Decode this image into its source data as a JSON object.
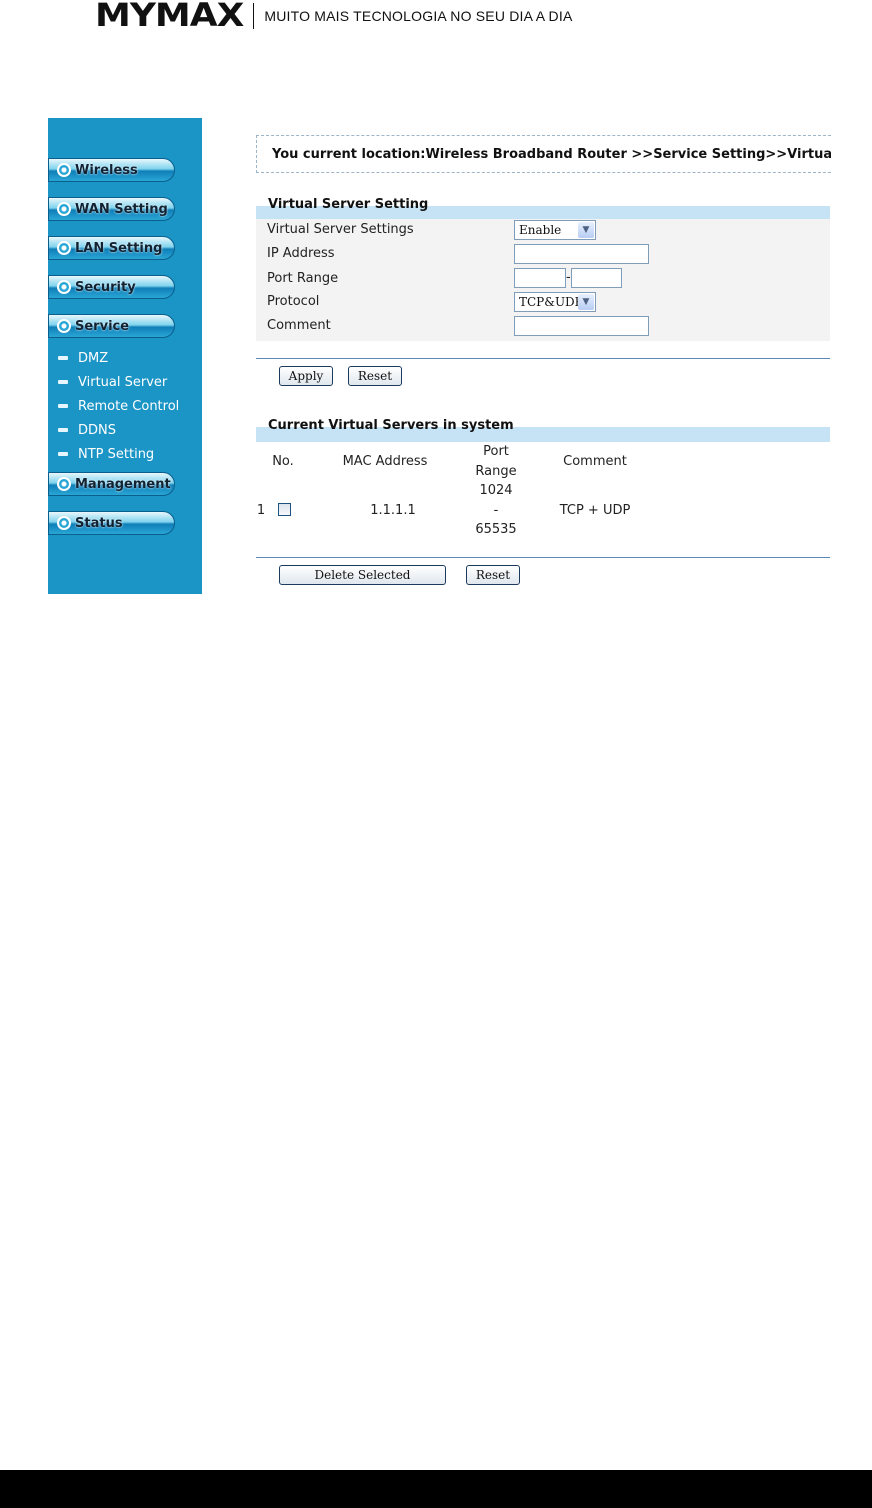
{
  "brand": {
    "logo_text": "MYMAX",
    "tagline": "MUITO MAIS TECNOLOGIA NO SEU DIA A DIA"
  },
  "sidebar": {
    "items": [
      {
        "label": "Wireless"
      },
      {
        "label": "WAN Setting"
      },
      {
        "label": "LAN Setting"
      },
      {
        "label": "Security"
      },
      {
        "label": "Service"
      }
    ],
    "service_sub": [
      {
        "label": "DMZ"
      },
      {
        "label": "Virtual Server"
      },
      {
        "label": "Remote Control"
      },
      {
        "label": "DDNS"
      },
      {
        "label": "NTP Setting"
      }
    ],
    "after": [
      {
        "label": "Management"
      },
      {
        "label": "Status"
      }
    ]
  },
  "location": {
    "text": "You current location:Wireless Broadband Router >>Service Setting>>Virtual Server"
  },
  "settings": {
    "title": "Virtual Server Setting",
    "rows": {
      "enable_label": "Virtual Server Settings",
      "enable_value": "Enable",
      "ip_label": "IP Address",
      "ip_value": "",
      "port_label": "Port Range",
      "port_from": "",
      "port_sep": "-",
      "port_to": "",
      "protocol_label": "Protocol",
      "protocol_value": "TCP&UDP",
      "comment_label": "Comment",
      "comment_value": ""
    },
    "apply_label": "Apply",
    "reset_label": "Reset"
  },
  "current": {
    "title": "Current Virtual Servers in system",
    "headers": {
      "no": "No.",
      "mac": "MAC Address",
      "port_l1": "Port",
      "port_l2": "Range",
      "comment": "Comment"
    },
    "rows": [
      {
        "no": "1",
        "mac": "1.1.1.1",
        "port_l1": "1024",
        "port_l2": "-",
        "port_l3": "65535",
        "comment": "TCP + UDP"
      }
    ],
    "delete_label": "Delete Selected",
    "reset_label": "Reset"
  }
}
